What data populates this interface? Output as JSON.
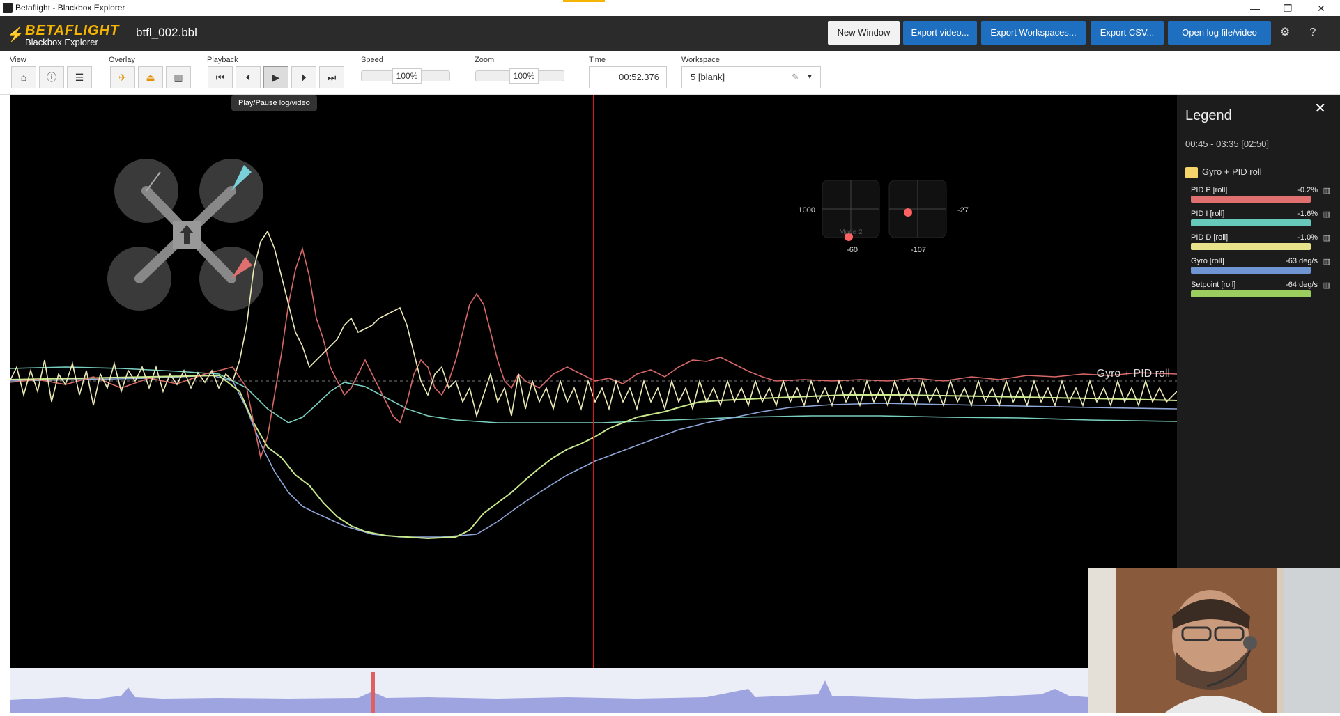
{
  "window": {
    "title": "Betaflight - Blackbox Explorer",
    "controls": [
      "—",
      "❐",
      "✕"
    ]
  },
  "header": {
    "brand": "BETAFLIGHT",
    "product": "Blackbox Explorer",
    "filename": "btfl_002.bbl",
    "buttons": {
      "new_window": "New Window",
      "export_video": "Export video...",
      "export_workspaces": "Export Workspaces...",
      "export_csv": "Export CSV...",
      "open_log": "Open log file/video"
    }
  },
  "toolbar": {
    "view_label": "View",
    "overlay_label": "Overlay",
    "playback_label": "Playback",
    "speed_label": "Speed",
    "speed_value": "100%",
    "zoom_label": "Zoom",
    "zoom_value": "100%",
    "time_label": "Time",
    "time_value": "00:52.376",
    "workspace_label": "Workspace",
    "workspace_value": "5 [blank]",
    "tooltip": "Play/Pause log/video"
  },
  "graph": {
    "title_overlay": "Gyro + PID roll",
    "stick_left": {
      "label_left": "1000",
      "label_bottom": "-60",
      "mode": "Mode 2"
    },
    "stick_right": {
      "label_right": "-27",
      "label_bottom": "-107"
    },
    "colors": {
      "pid_p": "#e07070",
      "pid_i": "#7ad0c0",
      "pid_d": "#e8e6a0",
      "gyro": "#8fa6d8",
      "setpoint": "#b8e07a",
      "cursor": "#e01818"
    }
  },
  "legend": {
    "title": "Legend",
    "range": "00:45 - 03:35 [02:50]",
    "group": "Gyro + PID roll",
    "items": [
      {
        "name": "PID P [roll]",
        "value": "-0.2%",
        "color": "#e07070"
      },
      {
        "name": "PID I [roll]",
        "value": "-1.6%",
        "color": "#66c9b9"
      },
      {
        "name": "PID D [roll]",
        "value": "-1.0%",
        "color": "#e8e28a"
      },
      {
        "name": "Gyro [roll]",
        "value": "-63 deg/s",
        "color": "#6f95d2"
      },
      {
        "name": "Setpoint [roll]",
        "value": "-64 deg/s",
        "color": "#9ccd5f"
      }
    ]
  }
}
